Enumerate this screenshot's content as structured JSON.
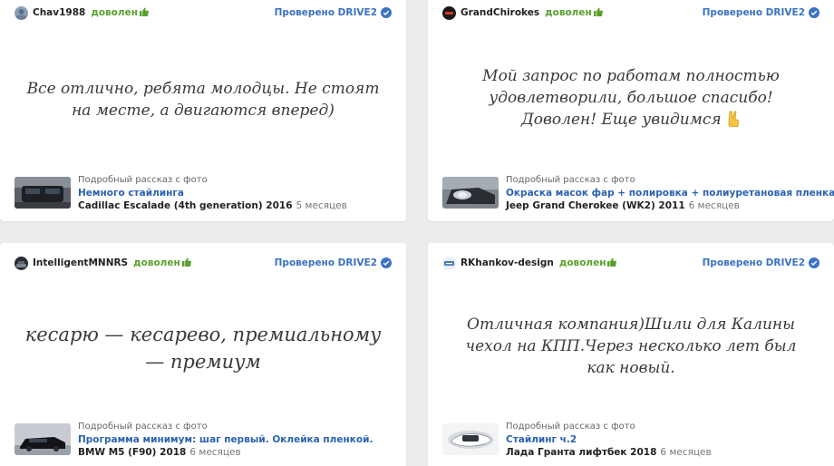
{
  "verified_label": "Проверено DRIVE2",
  "story_label": "Подробный рассказ с фото",
  "reviews": [
    {
      "author": "Chav1988",
      "status": "доволен",
      "quote": "Все отлично, ребята молодцы. Не стоят на месте, а двигаются вперед)",
      "story_title": "Немного стайлинга",
      "car": "Cadillac Escalade (4th generation) 2016",
      "time": "5 месяцев"
    },
    {
      "author": "GrandChirokes",
      "status": "доволен",
      "quote": "Мой запрос по работам полностью удовлетворили, большое спасибо! Доволен! Еще увидимся",
      "quote_emoji": "victory-hand-emoji",
      "story_title": "Окраска масок фар + полировка + полиуретановая пленка",
      "car": "Jeep Grand Cherokee (WK2) 2011",
      "time": "6 месяцев"
    },
    {
      "author": "IntelligentMNNRS",
      "status": "доволен",
      "quote": "кесарю — кесарево, премиальному — премиум",
      "story_title": "Программа минимум: шаг первый. Оклейка пленкой.",
      "car": "BMW M5 (F90) 2018",
      "time": "6 месяцев"
    },
    {
      "author": "RKhankov-design",
      "status": "доволен",
      "quote": "Отличная компания)Шили для Калины чехол на КПП.Через несколько лет был как новый.",
      "story_title": "Стайлинг ч.2",
      "car": "Лада Гранта лифтбек 2018",
      "time": "6 месяцев"
    }
  ],
  "colors": {
    "status_green": "#5aa02c",
    "link_blue": "#2b62b3",
    "verified_blue": "#3a72c4",
    "background": "#ececec"
  }
}
